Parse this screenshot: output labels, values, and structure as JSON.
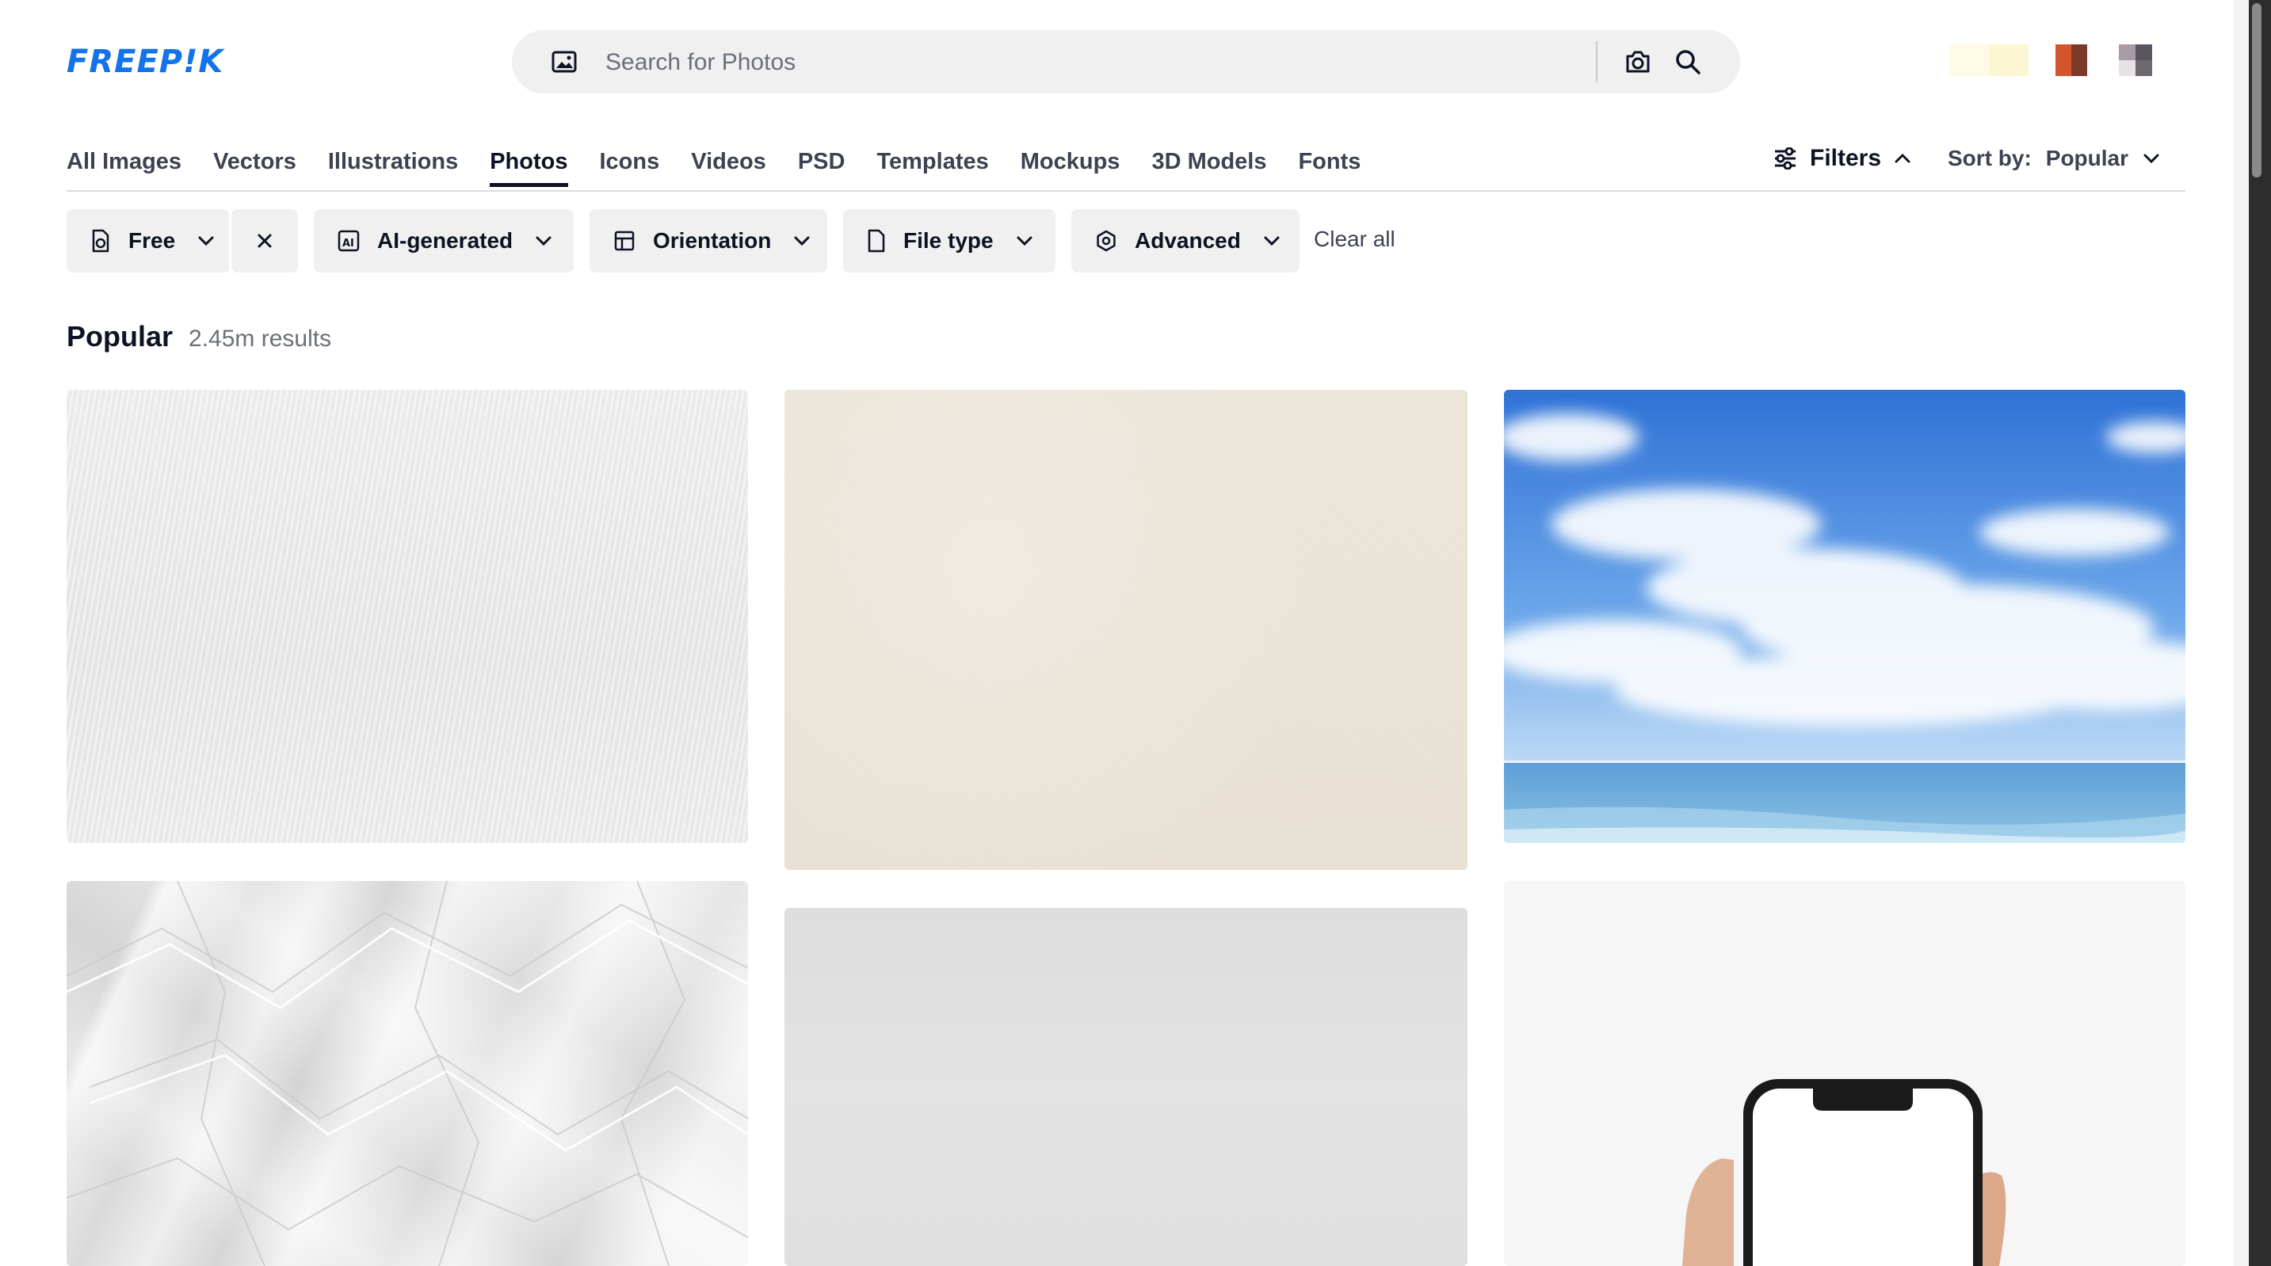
{
  "brand": {
    "logo_text": "FREEP!K",
    "accent_color": "#1273eb"
  },
  "search": {
    "placeholder": "Search for Photos",
    "value": "",
    "leading_icon": "image-icon",
    "camera_icon": "camera-icon",
    "submit_icon": "search-icon"
  },
  "header_swatches": [
    {
      "name": "pale-yellow-swatch",
      "colors": [
        "#fffbe6",
        "#fdf6d2"
      ]
    },
    {
      "name": "orange-swatch",
      "colors": [
        "#d4552c",
        "#7a3a28"
      ]
    },
    {
      "name": "gray-swatch",
      "colors": [
        "#a89aa6",
        "#5a5560"
      ]
    }
  ],
  "tabs": [
    {
      "label": "All Images",
      "active": false
    },
    {
      "label": "Vectors",
      "active": false
    },
    {
      "label": "Illustrations",
      "active": false
    },
    {
      "label": "Photos",
      "active": true
    },
    {
      "label": "Icons",
      "active": false
    },
    {
      "label": "Videos",
      "active": false
    },
    {
      "label": "PSD",
      "active": false
    },
    {
      "label": "Templates",
      "active": false
    },
    {
      "label": "Mockups",
      "active": false
    },
    {
      "label": "3D Models",
      "active": false
    },
    {
      "label": "Fonts",
      "active": false
    }
  ],
  "filters_toggle": {
    "label": "Filters",
    "icon": "sliders-icon",
    "expanded": true
  },
  "sort": {
    "label": "Sort by:",
    "value": "Popular"
  },
  "filter_chips": {
    "free": {
      "label": "Free",
      "icon": "free-file-icon"
    },
    "ai": {
      "label": "AI-generated",
      "icon": "ai-icon"
    },
    "orientation": {
      "label": "Orientation",
      "icon": "layout-icon"
    },
    "file_type": {
      "label": "File type",
      "icon": "file-icon"
    },
    "advanced": {
      "label": "Advanced",
      "icon": "gear-icon"
    },
    "clear_all": "Clear all"
  },
  "results": {
    "title": "Popular",
    "count": "2.45m results"
  },
  "images": [
    {
      "name": "white-paper-texture"
    },
    {
      "name": "beige-paper-texture"
    },
    {
      "name": "blue-sky-sea"
    },
    {
      "name": "crumpled-white-paper"
    },
    {
      "name": "gray-paper-texture"
    },
    {
      "name": "hand-holding-phone"
    }
  ]
}
